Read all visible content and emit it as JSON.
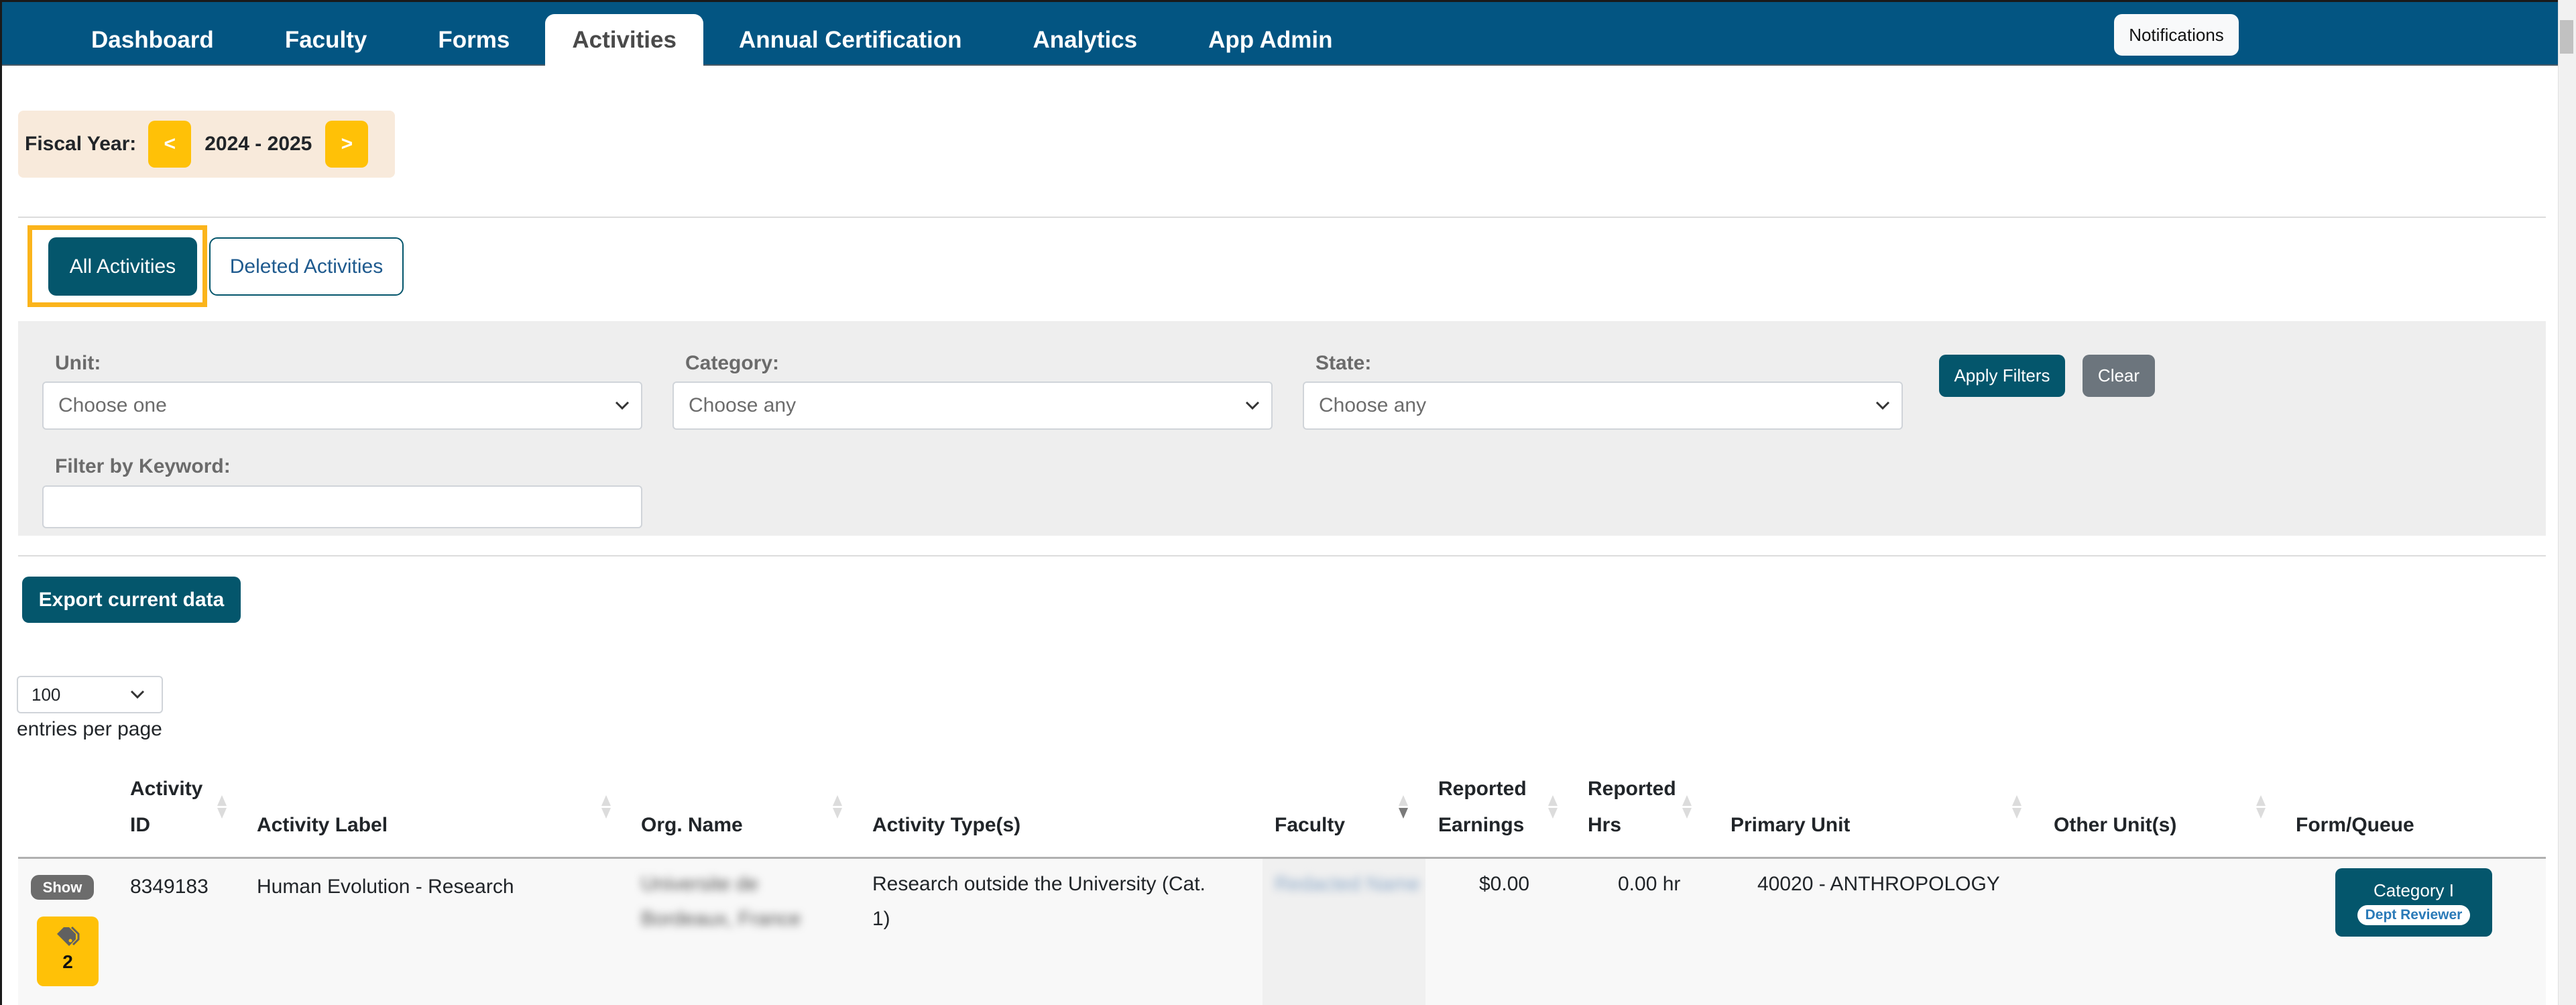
{
  "nav": {
    "tabs": [
      {
        "label": "Dashboard",
        "active": false
      },
      {
        "label": "Faculty",
        "active": false
      },
      {
        "label": "Forms",
        "active": false
      },
      {
        "label": "Activities",
        "active": true
      },
      {
        "label": "Annual Certification",
        "active": false
      },
      {
        "label": "Analytics",
        "active": false
      },
      {
        "label": "App Admin",
        "active": false
      }
    ],
    "notifications_label": "Notifications"
  },
  "fiscal_year": {
    "label": "Fiscal Year:",
    "prev": "<",
    "value": "2024 - 2025",
    "next": ">"
  },
  "activity_tabs": {
    "all_label": "All Activities",
    "deleted_label": "Deleted Activities",
    "selected": "All Activities"
  },
  "filters": {
    "unit": {
      "label": "Unit:",
      "value": "Choose one"
    },
    "category": {
      "label": "Category:",
      "value": "Choose any"
    },
    "state": {
      "label": "State:",
      "value": "Choose any"
    },
    "keyword": {
      "label": "Filter by Keyword:",
      "value": ""
    },
    "apply_label": "Apply Filters",
    "clear_label": "Clear"
  },
  "export_label": "Export current data",
  "entries": {
    "value": "100",
    "label": "entries per page"
  },
  "table": {
    "columns": [
      {
        "line1": "Activity",
        "line2": "ID"
      },
      {
        "line1": "",
        "line2": "Activity Label"
      },
      {
        "line1": "",
        "line2": "Org. Name"
      },
      {
        "line1": "",
        "line2": "Activity Type(s)"
      },
      {
        "line1": "",
        "line2": "Faculty",
        "sorted": "desc"
      },
      {
        "line1": "Reported",
        "line2": "Earnings"
      },
      {
        "line1": "Reported",
        "line2": "Hrs"
      },
      {
        "line1": "",
        "line2": "Primary Unit"
      },
      {
        "line1": "",
        "line2": "Other Unit(s)"
      },
      {
        "line1": "",
        "line2": "Form/Queue"
      }
    ],
    "rows": [
      {
        "show_label": "Show",
        "tag_count": "2",
        "activity_id": "8349183",
        "activity_label": "Human Evolution - Research",
        "org_name_line1": "Universite de",
        "org_name_line2": "Bordeaux, France",
        "activity_type_line1": "Research outside the University (Cat.",
        "activity_type_line2": "1)",
        "faculty": "Redacted Name",
        "reported_earnings": "$0.00",
        "reported_hrs": "0.00 hr",
        "primary_unit": "40020 - ANTHROPOLOGY",
        "other_units": "",
        "form_queue_title": "Category I",
        "form_queue_badge": "Dept Reviewer"
      }
    ]
  },
  "colors": {
    "nav_bg": "#035582",
    "primary_teal": "#04566c",
    "accent_yellow": "#ffc107",
    "highlight_orange": "#fbb41b",
    "secondary_gray": "#6c757d",
    "fiscal_bg": "#f8eadb",
    "filter_bg": "#eeeeee"
  }
}
